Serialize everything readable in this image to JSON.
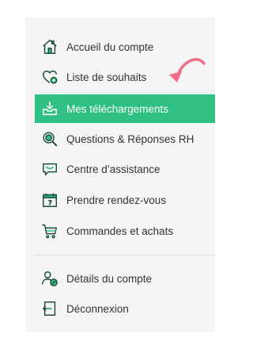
{
  "menu": {
    "items": [
      {
        "label": "Accueil du compte",
        "icon": "home-icon"
      },
      {
        "label": "Liste de souhaits",
        "icon": "heart-add-icon"
      },
      {
        "label": "Mes téléchargements",
        "icon": "download-tray-icon",
        "active": true
      },
      {
        "label": "Questions & Réponses RH",
        "icon": "magnifier-icon"
      },
      {
        "label": "Centre d’assistance",
        "icon": "chat-bubble-icon"
      },
      {
        "label": "Prendre rendez-vous",
        "icon": "calendar-icon"
      },
      {
        "label": "Commandes et achats",
        "icon": "cart-icon"
      }
    ],
    "account_items": [
      {
        "label": "Détails du compte",
        "icon": "user-edit-icon"
      },
      {
        "label": "Déconnexion",
        "icon": "logout-icon"
      }
    ]
  },
  "colors": {
    "active_bg": "#2fbf83",
    "active_text": "#ffffff",
    "icon_stroke": "#1f6b48",
    "icon_accent": "#2fbf83",
    "annotation_arrow": "#f06d8a"
  }
}
